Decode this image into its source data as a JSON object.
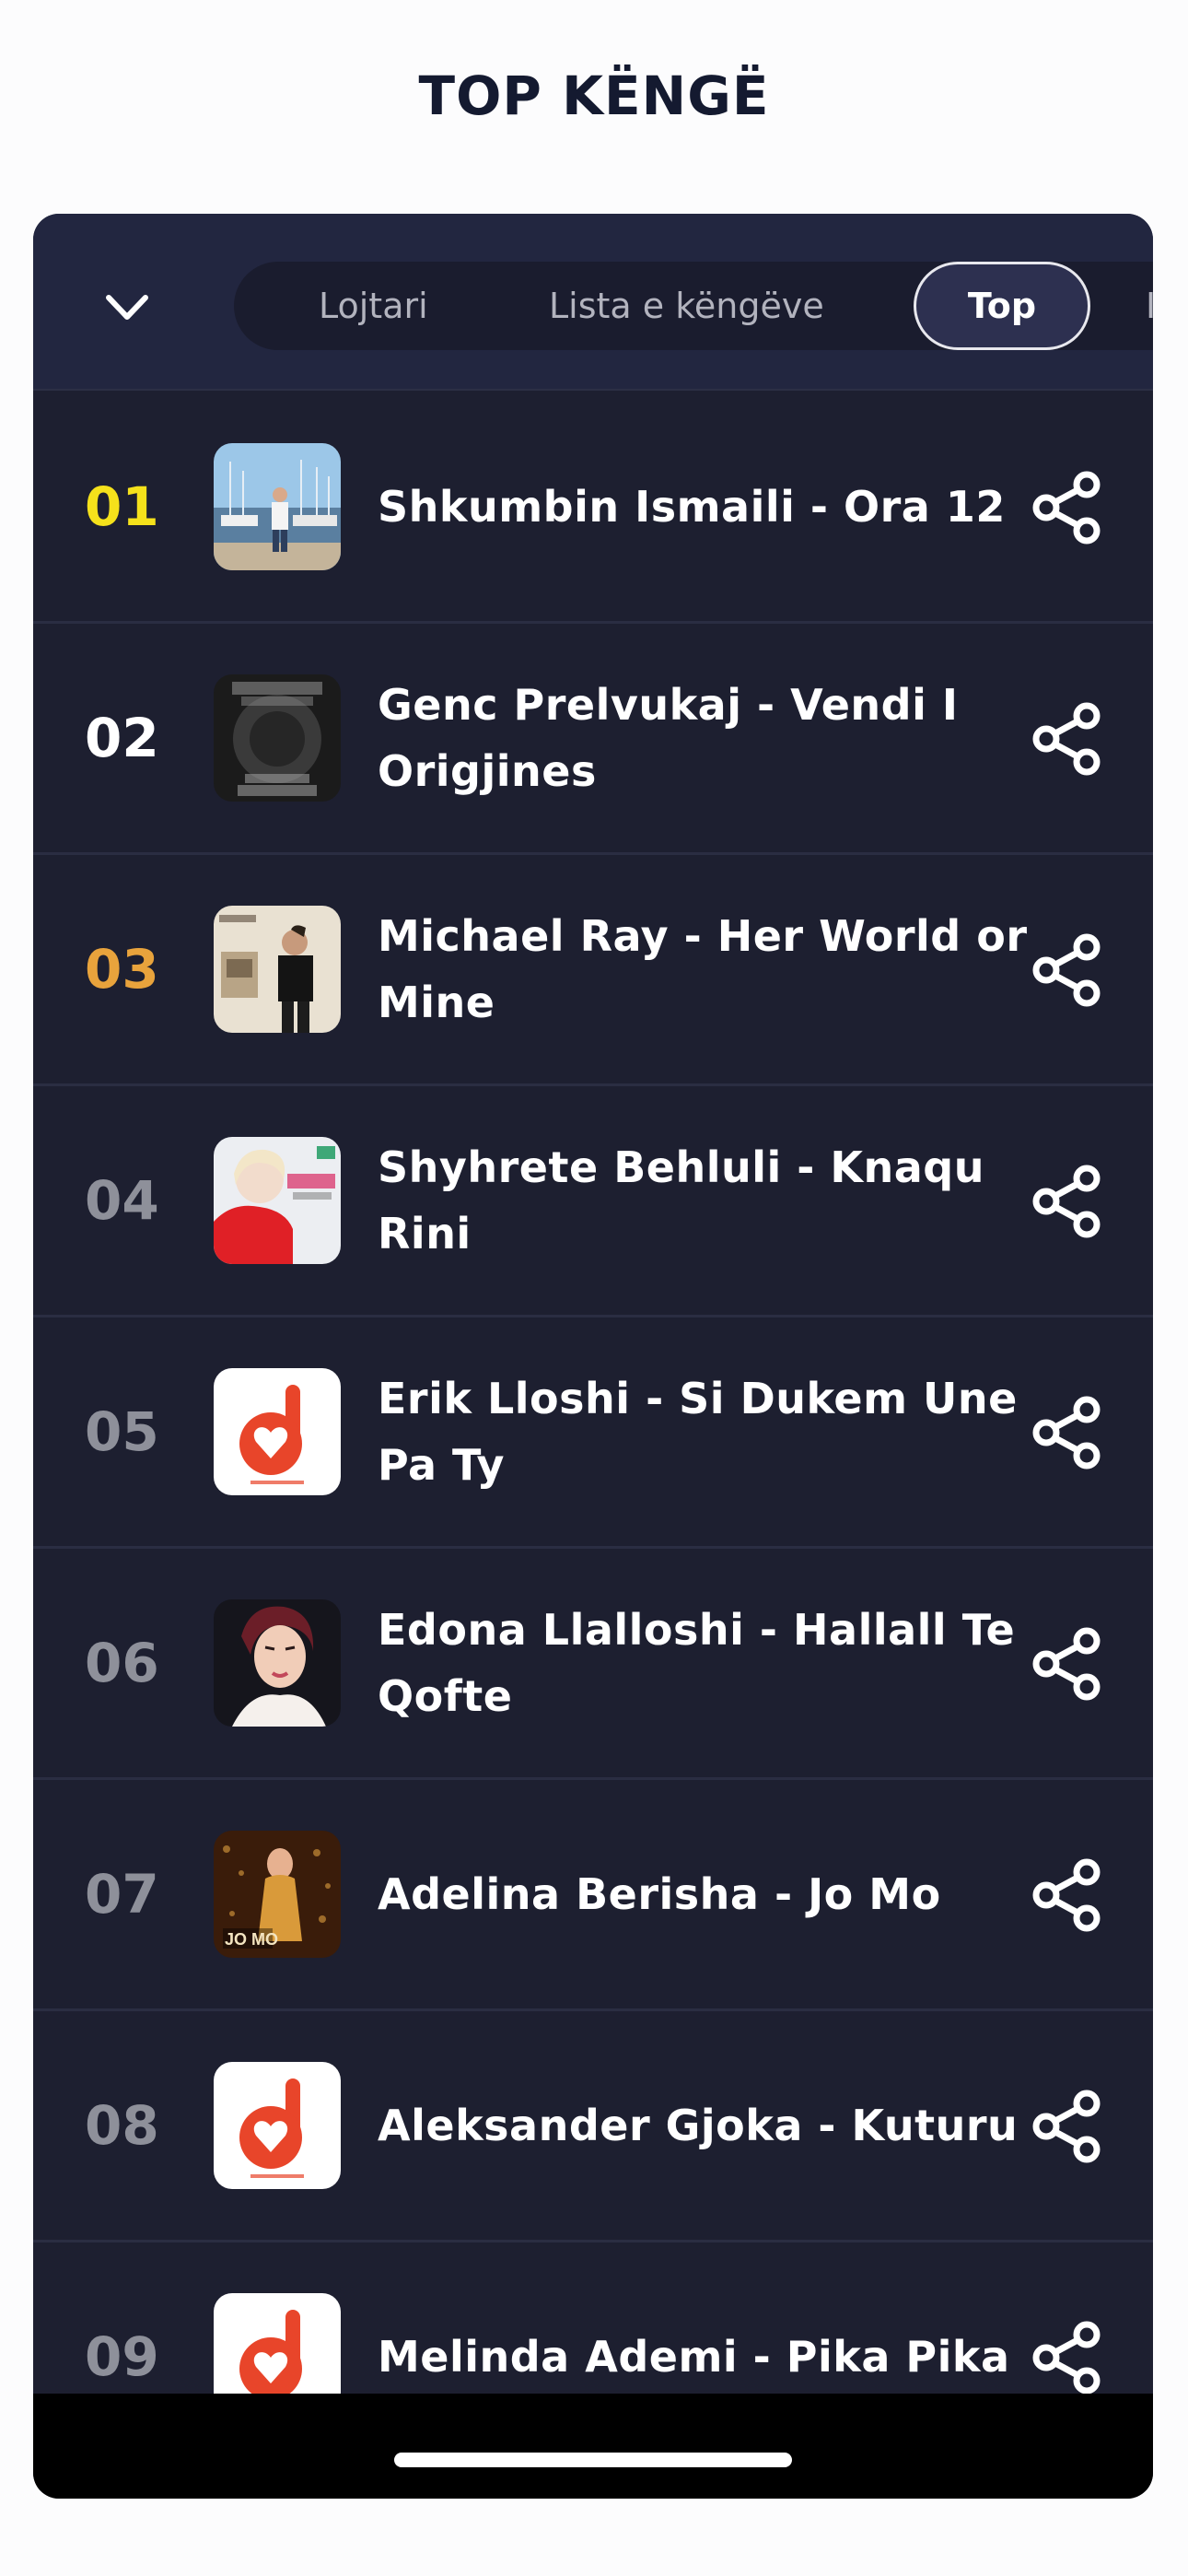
{
  "header": {
    "title": "TOP KËNGË"
  },
  "tabs": [
    {
      "label": "Lojtari",
      "active": false
    },
    {
      "label": "Lista e këngëve",
      "active": false
    },
    {
      "label": "Top",
      "active": true
    },
    {
      "label": "Inf",
      "active": false
    }
  ],
  "rank_colors": {
    "gold": "#f5e11b",
    "silver": "#ffffff",
    "bronze": "#e8a33c",
    "rest": "#8e909a"
  },
  "accent": "#e8452a",
  "songs": [
    {
      "rank": "01",
      "title": "Shkumbin Ismaili - Ora 12",
      "artwork": "harbor-photo"
    },
    {
      "rank": "02",
      "title": "Genc Prelvukaj - Vendi I Origjines",
      "artwork": "dark-album-cover"
    },
    {
      "rank": "03",
      "title": "Michael Ray - Her World or Mine",
      "artwork": "portrait-cover"
    },
    {
      "rank": "04",
      "title": "Shyhrete Behluli - Knaqu Rini",
      "artwork": "red-dress-cover"
    },
    {
      "rank": "05",
      "title": "Erik Lloshi - Si Dukem Une Pa Ty",
      "artwork": "radio-logo"
    },
    {
      "rank": "06",
      "title": "Edona Llalloshi - Hallall Te Qofte",
      "artwork": "portrait-dark"
    },
    {
      "rank": "07",
      "title": "Adelina Berisha - Jo Mo",
      "artwork": "gold-cover"
    },
    {
      "rank": "08",
      "title": "Aleksander Gjoka - Kuturu",
      "artwork": "radio-logo"
    },
    {
      "rank": "09",
      "title": "Melinda Ademi - Pika Pika",
      "artwork": "radio-logo"
    }
  ]
}
